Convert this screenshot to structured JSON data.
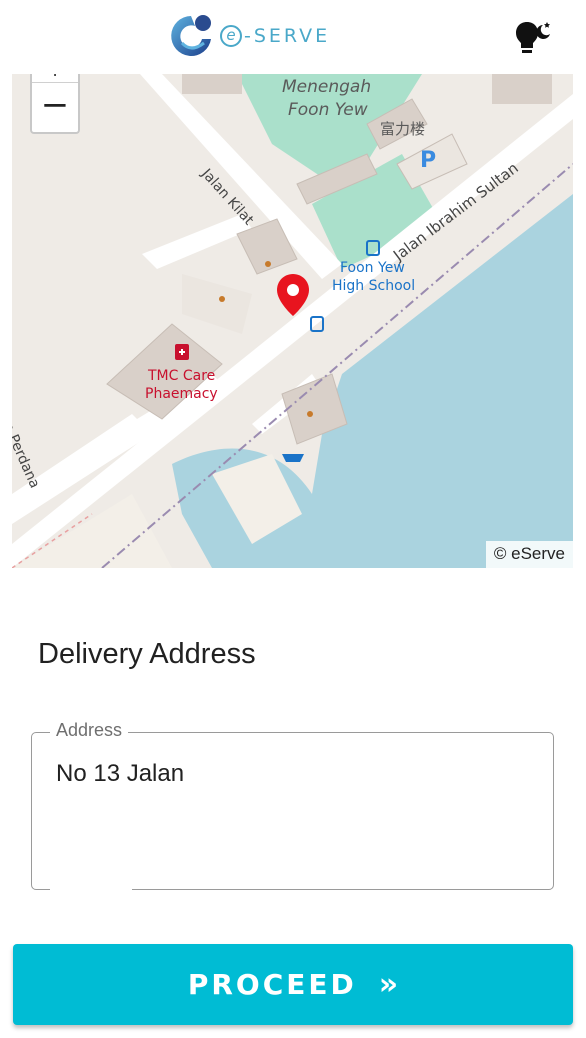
{
  "header": {
    "logo_letter": "e",
    "logo_word": "-SERVE",
    "theme_toggle_icon": "lightbulb-moon-icon"
  },
  "map": {
    "zoom_in_label": "+",
    "zoom_out_label": "−",
    "attribution": "© eServe",
    "labels": {
      "school_name_1": "Menengah",
      "school_name_2": "Foon Yew",
      "building_cn": "富力楼",
      "road_1": "Jalan Kilat",
      "road_2": "Jalan Ibrahim Sultan",
      "poi_1_line1": "Foon Yew",
      "poi_1_line2": "High School",
      "poi_2_line1": "TMC Care",
      "poi_2_line2": "Phaemacy",
      "road_3": "n Perdana",
      "parking": "P"
    },
    "pin_color": "#e8141f"
  },
  "delivery": {
    "title": "Delivery Address",
    "address_label": "Address",
    "address_value": "No 13 Jalan"
  },
  "actions": {
    "proceed_label": "PROCEED",
    "proceed_icon": "»"
  },
  "colors": {
    "accent": "#00bcd4",
    "logo": "#4aa8c9",
    "water": "#aad3df",
    "school": "#aae0cb"
  }
}
